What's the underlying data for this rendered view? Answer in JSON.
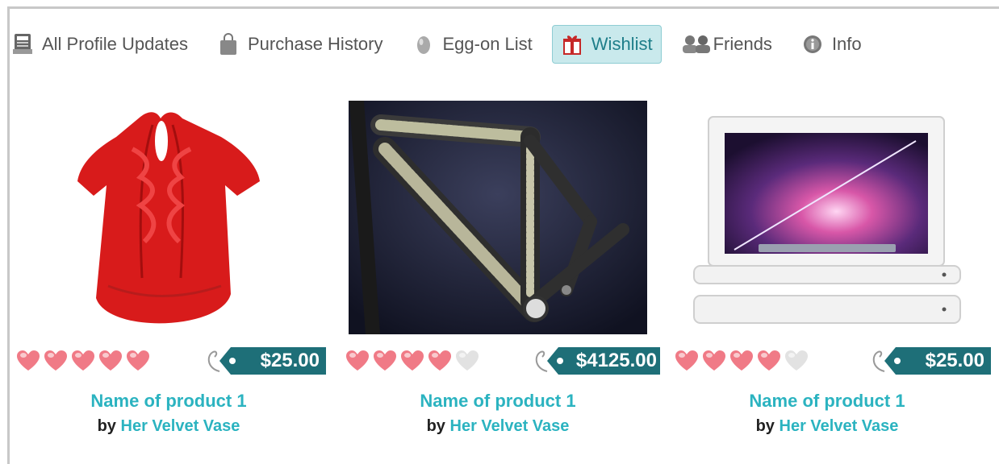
{
  "tabs": [
    {
      "label": "All Profile Updates",
      "icon": "newspaper-icon",
      "active": false
    },
    {
      "label": "Purchase History",
      "icon": "shopping-bag-icon",
      "active": false
    },
    {
      "label": "Egg-on List",
      "icon": "egg-icon",
      "active": false
    },
    {
      "label": "Wishlist",
      "icon": "gift-icon",
      "active": true
    },
    {
      "label": "Friends",
      "icon": "friends-icon",
      "active": false
    },
    {
      "label": "Info",
      "icon": "info-icon",
      "active": false
    }
  ],
  "products": [
    {
      "image": "red-blouse-image",
      "rating": 5,
      "rating_max": 5,
      "price": "$25.00",
      "name": "Name of product 1",
      "by_prefix": "by",
      "seller": "Her Velvet Vase"
    },
    {
      "image": "bicycle-frame-image",
      "rating": 4,
      "rating_max": 5,
      "price": "$4125.00",
      "name": "Name of product 1",
      "by_prefix": "by",
      "seller": "Her Velvet Vase"
    },
    {
      "image": "laptop-image",
      "rating": 4,
      "rating_max": 5,
      "price": "$25.00",
      "name": "Name of product 1",
      "by_prefix": "by",
      "seller": "Her Velvet Vase"
    }
  ],
  "colors": {
    "accent": "#2bb3c0",
    "price_tag": "#1e6f78",
    "active_tab_bg": "#c9e9ec",
    "heart_filled": "#f07a86",
    "heart_empty": "#e2e2e2"
  }
}
